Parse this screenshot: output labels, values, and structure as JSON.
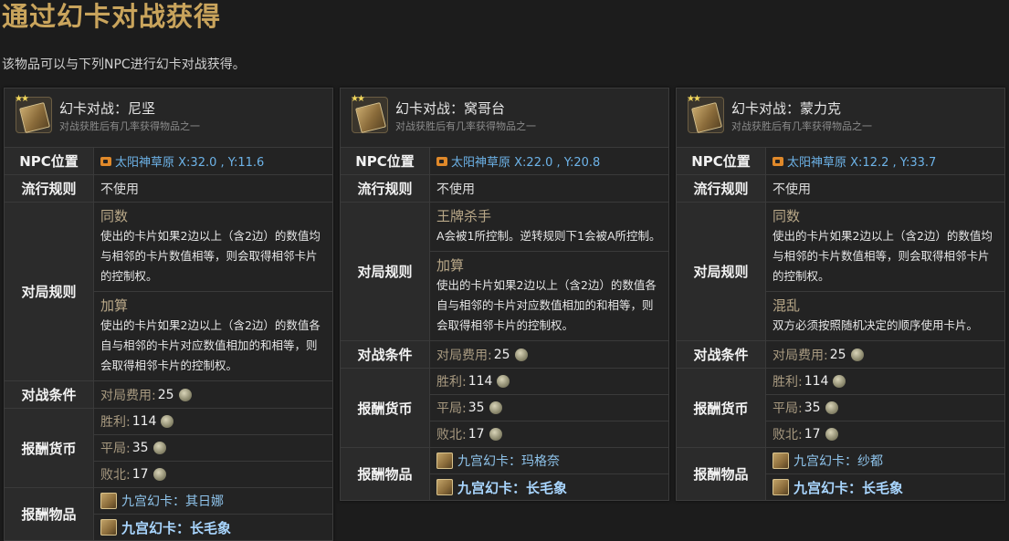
{
  "page": {
    "title": "通过幻卡对战获得",
    "intro": "该物品可以与下列NPC进行幻卡对战获得。"
  },
  "labels": {
    "npc_location": "NPC位置",
    "rules_trend": "流行规则",
    "match_rules": "对局规则",
    "conditions": "对战条件",
    "reward_currency": "报酬货币",
    "reward_items": "报酬物品",
    "fee": "对局费用:",
    "win": "胜利:",
    "draw": "平局:",
    "lose": "败北:"
  },
  "cards": [
    {
      "title": "幻卡对战：尼坚",
      "subtitle": "对战获胜后有几率获得物品之一",
      "location": "太阳神草原 X:32.0 , Y:11.6",
      "trend_rule": "不使用",
      "rules": [
        {
          "name": "同数",
          "desc": "使出的卡片如果2边以上（含2边）的数值均与相邻的卡片数值相等，则会取得相邻卡片的控制权。"
        },
        {
          "name": "加算",
          "desc": "使出的卡片如果2边以上（含2边）的数值各自与相邻的卡片对应数值相加的和相等，则会取得相邻卡片的控制权。"
        }
      ],
      "fee": "25",
      "win": "114",
      "draw": "35",
      "lose": "17",
      "rewards": [
        "九宫幻卡：其日娜",
        "九宫幻卡：长毛象"
      ]
    },
    {
      "title": "幻卡对战：窝哥台",
      "subtitle": "对战获胜后有几率获得物品之一",
      "location": "太阳神草原 X:22.0 , Y:20.8",
      "trend_rule": "不使用",
      "rules": [
        {
          "name": "王牌杀手",
          "desc": "A会被1所控制。逆转规则下1会被A所控制。"
        },
        {
          "name": "加算",
          "desc": "使出的卡片如果2边以上（含2边）的数值各自与相邻的卡片对应数值相加的和相等，则会取得相邻卡片的控制权。"
        }
      ],
      "fee": "25",
      "win": "114",
      "draw": "35",
      "lose": "17",
      "rewards": [
        "九宫幻卡：玛格奈",
        "九宫幻卡：长毛象"
      ]
    },
    {
      "title": "幻卡对战：蒙力克",
      "subtitle": "对战获胜后有几率获得物品之一",
      "location": "太阳神草原 X:12.2 , Y:33.7",
      "trend_rule": "不使用",
      "rules": [
        {
          "name": "同数",
          "desc": "使出的卡片如果2边以上（含2边）的数值均与相邻的卡片数值相等，则会取得相邻卡片的控制权。"
        },
        {
          "name": "混乱",
          "desc": "双方必须按照随机决定的顺序使用卡片。"
        }
      ],
      "fee": "25",
      "win": "114",
      "draw": "35",
      "lose": "17",
      "rewards": [
        "九宫幻卡：纱都",
        "九宫幻卡：长毛象"
      ]
    }
  ]
}
